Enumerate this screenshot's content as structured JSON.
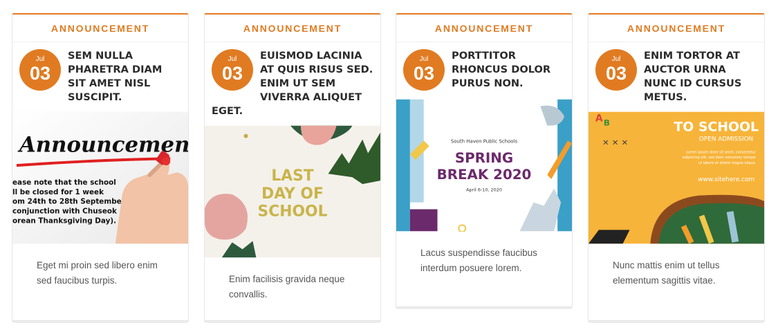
{
  "cards": [
    {
      "category": "ANNOUNCEMENT",
      "month": "Jul",
      "day": "03",
      "title": "SEM NULLA PHARETRA DIAM SIT AMET NISL SUSCIPIT.",
      "excerpt": "Eget mi proin sed libero enim sed faucibus turpis.",
      "image": {
        "heading": "Announcement",
        "lines": [
          "ease note that the school",
          "ll be closed for 1 week",
          "om 24th to 28th September",
          "conjunction with Chuseok",
          "orean Thanksgiving Day)."
        ]
      }
    },
    {
      "category": "ANNOUNCEMENT",
      "month": "Jul",
      "day": "03",
      "title": "EUISMOD LACINIA AT QUIS RISUS SED. ENIM UT SEM VIVERRA ALIQUET EGET.",
      "excerpt": "Enim facilisis gravida neque convallis.",
      "image": {
        "line1": "LAST",
        "line2": "DAY OF",
        "line3": "SCHOOL"
      }
    },
    {
      "category": "ANNOUNCEMENT",
      "month": "Jul",
      "day": "03",
      "title": "PORTTITOR RHONCUS DOLOR PURUS NON.",
      "excerpt": "Lacus suspendisse faucibus interdum posuere lorem.",
      "image": {
        "org": "South Haven Public Schools",
        "line1": "SPRING",
        "line2": "BREAK 2020",
        "dates": "April 6-10, 2020"
      }
    },
    {
      "category": "ANNOUNCEMENT",
      "month": "Jul",
      "day": "03",
      "title": "ENIM TORTOR AT AUCTOR URNA NUNC ID CURSUS METUS.",
      "excerpt": "Nunc mattis enim ut tellus elementum sagittis vitae.",
      "image": {
        "heading": "TO SCHOOL",
        "sub": "OPEN ADMISSION",
        "body1": "Lorem ipsum dolor sit amet, consectetur",
        "body2": "adipiscing elit, sed diam nonummy tempor",
        "body3": "ut labore et dolore magna aliqua.",
        "url": "www.sitehere.com"
      }
    }
  ],
  "colors": {
    "accent": "#e07b22",
    "border": "#e6e6e6"
  }
}
